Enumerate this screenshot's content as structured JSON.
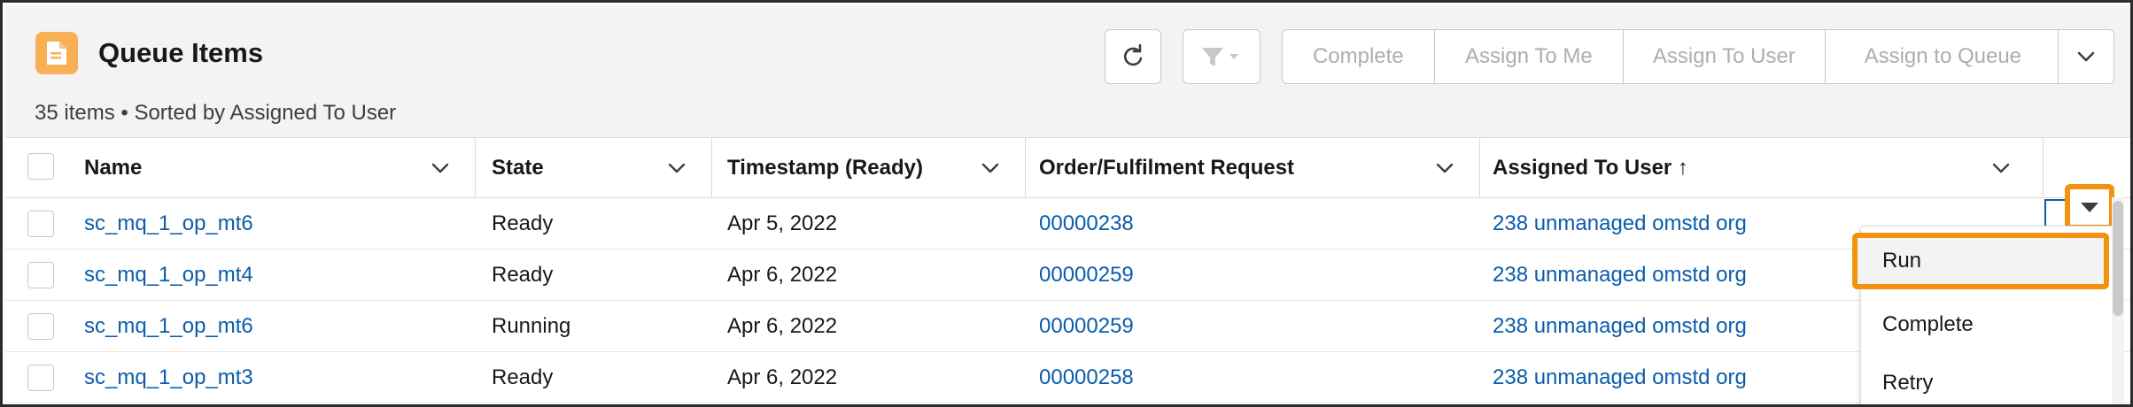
{
  "header": {
    "title": "Queue Items",
    "subtitle": "35 items • Sorted by Assigned To User",
    "icon": "document-icon"
  },
  "toolbar": {
    "refresh_icon": "refresh-icon",
    "filter_icon": "filter-icon",
    "actions": [
      "Complete",
      "Assign To Me",
      "Assign To User",
      "Assign to Queue"
    ],
    "more_icon": "chevron-down-icon"
  },
  "table": {
    "columns": [
      {
        "label": "Name"
      },
      {
        "label": "State"
      },
      {
        "label": "Timestamp (Ready)"
      },
      {
        "label": "Order/Fulfilment Request"
      },
      {
        "label": "Assigned To User ↑"
      }
    ],
    "rows": [
      {
        "name": "sc_mq_1_op_mt6",
        "state": "Ready",
        "timestamp": "Apr 5, 2022",
        "order": "00000238",
        "assigned": "238 unmanaged omstd org"
      },
      {
        "name": "sc_mq_1_op_mt4",
        "state": "Ready",
        "timestamp": "Apr 6, 2022",
        "order": "00000259",
        "assigned": "238 unmanaged omstd org"
      },
      {
        "name": "sc_mq_1_op_mt6",
        "state": "Running",
        "timestamp": "Apr 6, 2022",
        "order": "00000259",
        "assigned": "238 unmanaged omstd org"
      },
      {
        "name": "sc_mq_1_op_mt3",
        "state": "Ready",
        "timestamp": "Apr 6, 2022",
        "order": "00000258",
        "assigned": "238 unmanaged omstd org"
      }
    ]
  },
  "row_menu": {
    "items": [
      "Run",
      "Complete",
      "Retry"
    ],
    "highlighted": "Run"
  },
  "colors": {
    "accent_highlight": "#f2920e",
    "link": "#0b5cab",
    "app_icon": "#f9b055"
  }
}
